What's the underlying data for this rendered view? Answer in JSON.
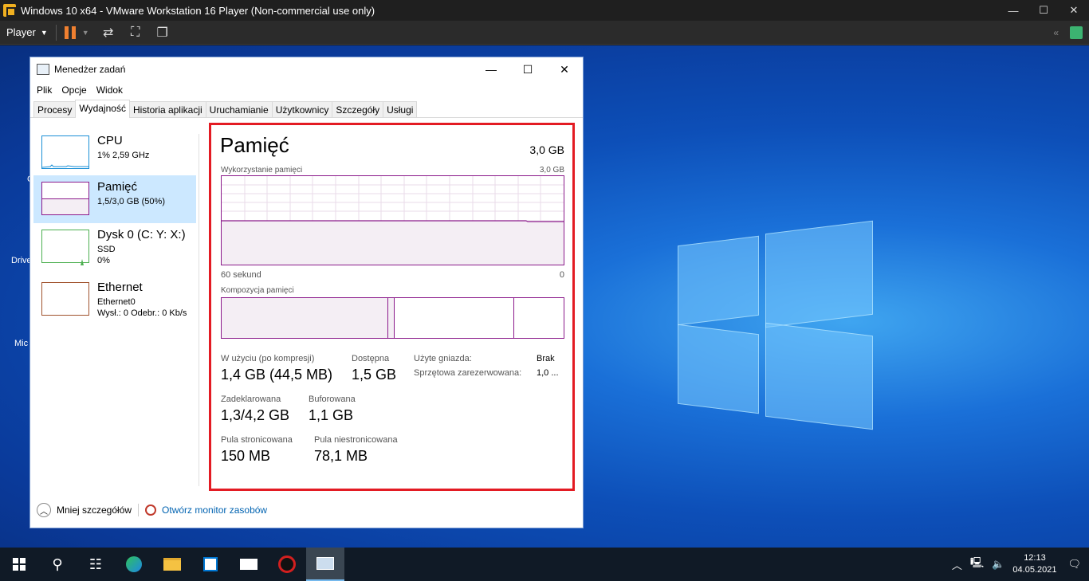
{
  "vm": {
    "title": "Windows 10 x64 - VMware Workstation 16 Player (Non-commercial use only)",
    "player_label": "Player"
  },
  "desktop_icons": [
    "C",
    "Drive",
    "Mic"
  ],
  "taskmgr": {
    "title": "Menedżer zadań",
    "menu": [
      "Plik",
      "Opcje",
      "Widok"
    ],
    "tabs": [
      "Procesy",
      "Wydajność",
      "Historia aplikacji",
      "Uruchamianie",
      "Użytkownicy",
      "Szczegóły",
      "Usługi"
    ],
    "active_tab": "Wydajność",
    "left_items": [
      {
        "label": "CPU",
        "sub1": "1% 2,59 GHz",
        "sub2": "",
        "color": "#1a8fd6"
      },
      {
        "label": "Pamięć",
        "sub1": "1,5/3,0 GB (50%)",
        "sub2": "",
        "color": "#8b1a8b"
      },
      {
        "label": "Dysk 0 (C: Y: X:)",
        "sub1": "SSD",
        "sub2": "0%",
        "color": "#4caf50"
      },
      {
        "label": "Ethernet",
        "sub1": "Ethernet0",
        "sub2": "Wysł.: 0 Odebr.: 0 Kb/s",
        "color": "#a0522d"
      }
    ],
    "detail": {
      "title": "Pamięć",
      "total": "3,0 GB",
      "usage_label": "Wykorzystanie pamięci",
      "usage_max": "3,0 GB",
      "time_left": "60 sekund",
      "time_right": "0",
      "usage_fraction": 0.5,
      "composition_label": "Kompozycja pamięci",
      "composition": {
        "in_use": 0.484,
        "modified": 0.02,
        "standby": 0.35
      },
      "stats": {
        "in_use_label": "W użyciu (po kompresji)",
        "in_use_value": "1,4 GB (44,5 MB)",
        "available_label": "Dostępna",
        "available_value": "1,5 GB",
        "committed_label": "Zadeklarowana",
        "committed_value": "1,3/4,2 GB",
        "cached_label": "Buforowana",
        "cached_value": "1,1 GB",
        "paged_label": "Pula stronicowana",
        "paged_value": "150 MB",
        "nonpaged_label": "Pula niestronicowana",
        "nonpaged_value": "78,1 MB",
        "slots_label": "Użyte gniazda:",
        "slots_value": "Brak",
        "hw_reserved_label": "Sprzętowa zarezerwowana:",
        "hw_reserved_value": "1,0 ..."
      }
    },
    "footer": {
      "fewer_details": "Mniej szczegółów",
      "resource_monitor": "Otwórz monitor zasobów"
    }
  },
  "taskbar": {
    "time": "12:13",
    "date": "04.05.2021"
  },
  "colors": {
    "memory_accent": "#8b1a8b",
    "highlight_box": "#e31b23"
  }
}
